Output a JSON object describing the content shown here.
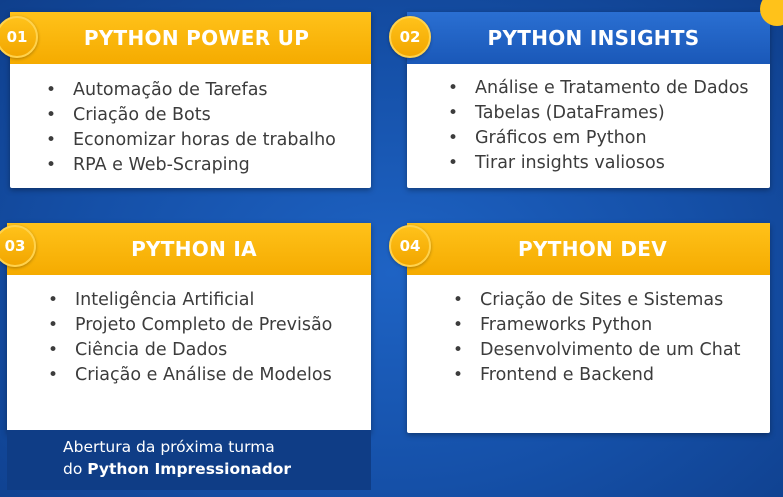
{
  "cards": [
    {
      "number": "01",
      "title": "PYTHON POWER UP",
      "items": [
        "Automação de Tarefas",
        "Criação de Bots",
        "Economizar horas de trabalho",
        "RPA e Web-Scraping"
      ]
    },
    {
      "number": "02",
      "title": "PYTHON INSIGHTS",
      "items": [
        "Análise e Tratamento de Dados",
        "Tabelas (DataFrames)",
        "Gráficos em Python",
        "Tirar insights valiosos"
      ]
    },
    {
      "number": "03",
      "title": "PYTHON IA",
      "items": [
        "Inteligência Artificial",
        "Projeto Completo de Previsão",
        "Ciência de Dados",
        "Criação e Análise de Modelos"
      ]
    },
    {
      "number": "04",
      "title": "PYTHON DEV",
      "items": [
        "Criação de Sites e Sistemas",
        "Frameworks Python",
        "Desenvolvimento de um Chat",
        "Frontend e Backend"
      ]
    }
  ],
  "footer": {
    "line1": "Abertura da próxima turma",
    "line2_prefix": "do ",
    "line2_bold": "Python Impressionador"
  },
  "colors": {
    "orange": "#f5ab00",
    "blue": "#1a58b8",
    "background": "#1550a8"
  }
}
